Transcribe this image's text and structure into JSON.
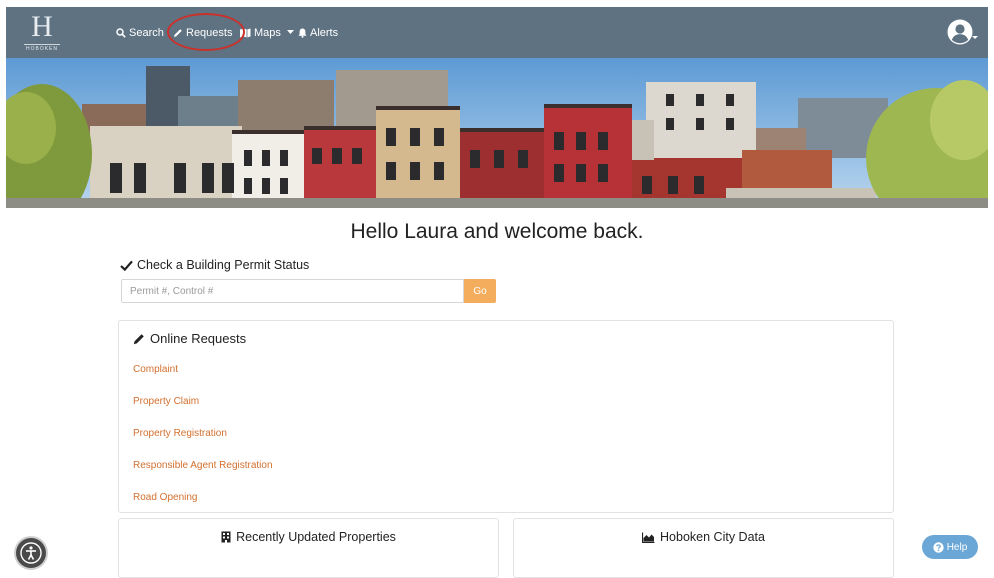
{
  "logo": {
    "letter": "H",
    "subtitle": "HOBOKEN"
  },
  "nav": {
    "search": "Search",
    "requests": "Requests",
    "maps": "Maps",
    "alerts": "Alerts"
  },
  "welcome": "Hello Laura and welcome back.",
  "permit": {
    "label": "Check a Building Permit Status",
    "placeholder": "Permit #, Control #",
    "go": "Go"
  },
  "online_requests": {
    "title": "Online Requests",
    "items": [
      "Complaint",
      "Property Claim",
      "Property Registration",
      "Responsible Agent Registration",
      "Road Opening"
    ]
  },
  "cards": {
    "recent_properties": "Recently Updated Properties",
    "city_data": "Hoboken City Data"
  },
  "help": "Help",
  "colors": {
    "topbar": "#5e7282",
    "link": "#d3702f",
    "go_button": "#f4ad5c",
    "highlight_circle": "#c9312a",
    "help_button": "#6aa6d6"
  },
  "icons": [
    "search-icon",
    "pencil-icon",
    "map-icon",
    "bell-icon",
    "user-avatar-icon",
    "check-icon",
    "building-icon",
    "area-chart-icon",
    "accessibility-icon",
    "question-circle-icon"
  ]
}
